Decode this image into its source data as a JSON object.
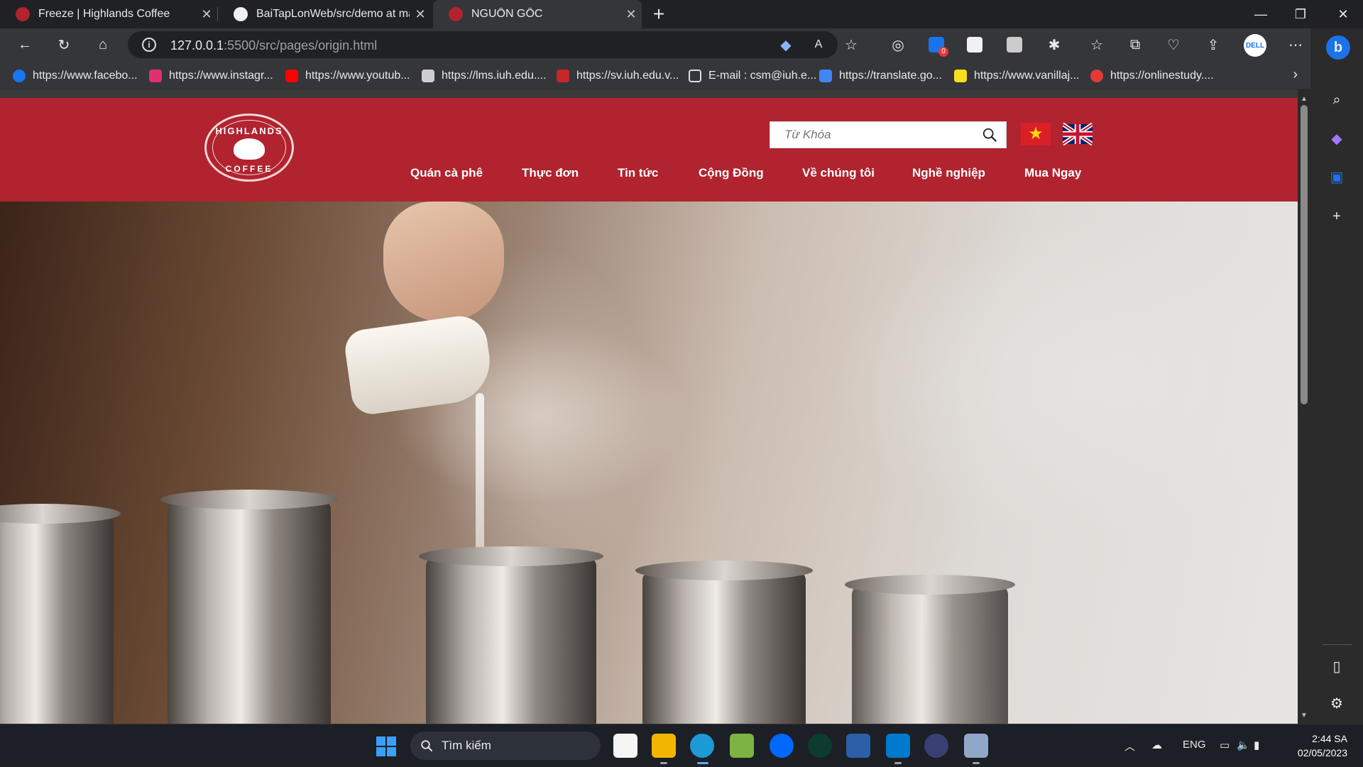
{
  "browser": {
    "tabs": [
      {
        "title": "Freeze | Highlands Coffee",
        "active": false
      },
      {
        "title": "BaiTapLonWeb/src/demo at main",
        "active": false
      },
      {
        "title": "NGUỒN GỐC",
        "active": true
      }
    ],
    "url_host": "127.0.0.1",
    "url_path": ":5500/src/pages/origin.html",
    "bookmarks": [
      "https://www.facebo...",
      "https://www.instagr...",
      "https://www.youtub...",
      "https://lms.iuh.edu....",
      "https://sv.iuh.edu.v...",
      "E-mail : csm@iuh.e...",
      "https://translate.go...",
      "https://www.vanillaj...",
      "https://onlinestudy...."
    ],
    "extension_badge": "0",
    "accent": "#3aa0ff"
  },
  "site": {
    "brand_color": "#b0232f",
    "logo": {
      "top": "HIGHLANDS",
      "bottom": "COFFEE"
    },
    "search_placeholder": "Từ Khóa",
    "nav": [
      "Quán cà phê",
      "Thực đơn",
      "Tin tức",
      "Cộng Đồng",
      "Về chúng tôi",
      "Nghề nghiệp",
      "Mua Ngay"
    ],
    "languages": [
      "vi",
      "en"
    ]
  },
  "taskbar": {
    "search_label": "Tìm kiếm",
    "language": "ENG",
    "time": "2:44 SA",
    "date": "02/05/2023"
  }
}
